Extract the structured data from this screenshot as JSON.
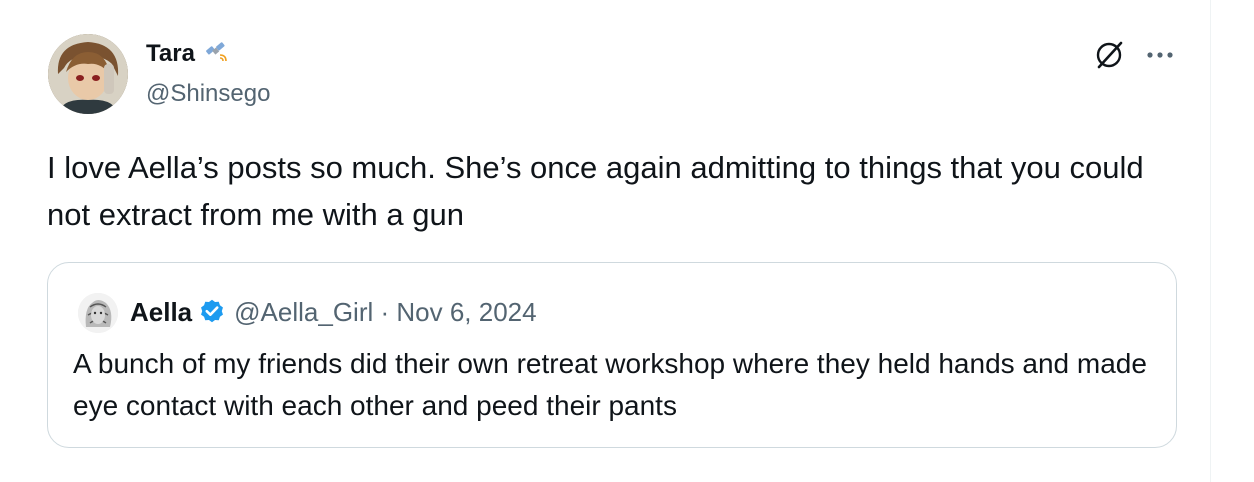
{
  "author": {
    "name": "Tara",
    "handle": "@Shinsego",
    "emoji_icon": "satellite-icon"
  },
  "tweet": {
    "text": "I love Aella’s posts so much. She’s once again admitting to things that you could not extract from me with a gun"
  },
  "actions": {
    "grok_icon": "grok-icon",
    "more_icon": "more-options-icon"
  },
  "quoted_tweet": {
    "name": "Aella",
    "handle_date": "@Aella_Girl · Nov 6, 2024",
    "text": "A bunch of my friends did their own retreat workshop where they held hands and made eye contact with each other and peed their pants",
    "verified_icon": "verified-badge-icon"
  },
  "colors": {
    "text": "#0f1419",
    "secondary": "#536471",
    "verified": "#1d9bf0",
    "border": "#cfd9de"
  }
}
